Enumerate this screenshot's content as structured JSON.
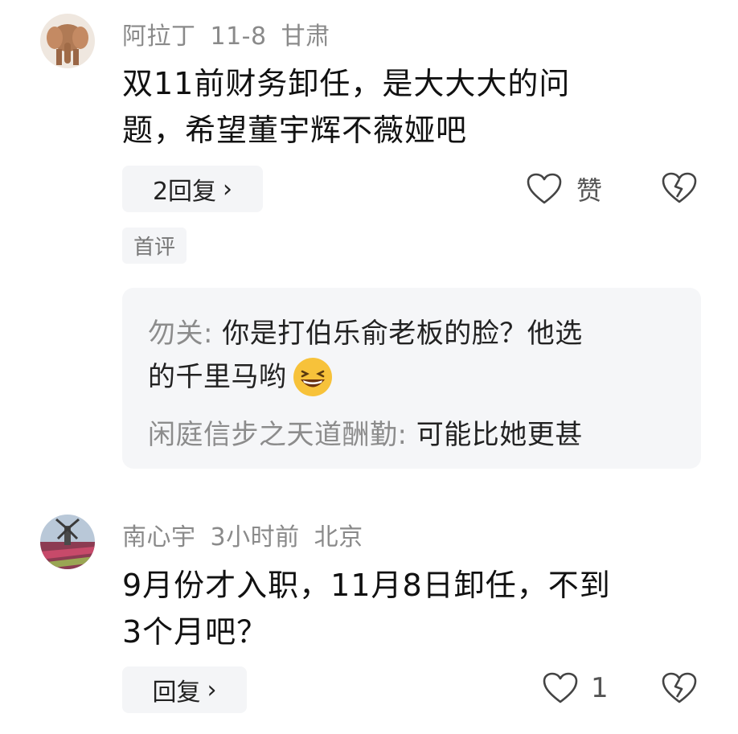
{
  "comments": [
    {
      "user": "阿拉丁",
      "time": "11-8",
      "location": "甘肃",
      "text_line1": "双11前财务卸任，是大大大的问",
      "text_line2": "题，希望董宇辉不薇娅吧",
      "reply_button": "2回复",
      "like_label": "赞",
      "tag": "首评",
      "replies": [
        {
          "name": "勿关",
          "sep": ": ",
          "text_line1": "你是打伯乐俞老板的脸？他选",
          "text_line2": "的千里马哟",
          "emoji": "grinning-face-icon"
        },
        {
          "name": "闲庭信步之天道酬勤",
          "sep": ": ",
          "text": "可能比她更甚"
        }
      ]
    },
    {
      "user": "南心宇",
      "time": "3小时前",
      "location": "北京",
      "text_line1": "9月份才入职，11月8日卸任，不到",
      "text_line2": "3个月吧？",
      "reply_button": "回复",
      "like_count": "1"
    }
  ],
  "chevron": "›",
  "colors": {
    "meta": "#8a8a8a",
    "text": "#111111",
    "pill_bg": "#f4f5f7"
  }
}
